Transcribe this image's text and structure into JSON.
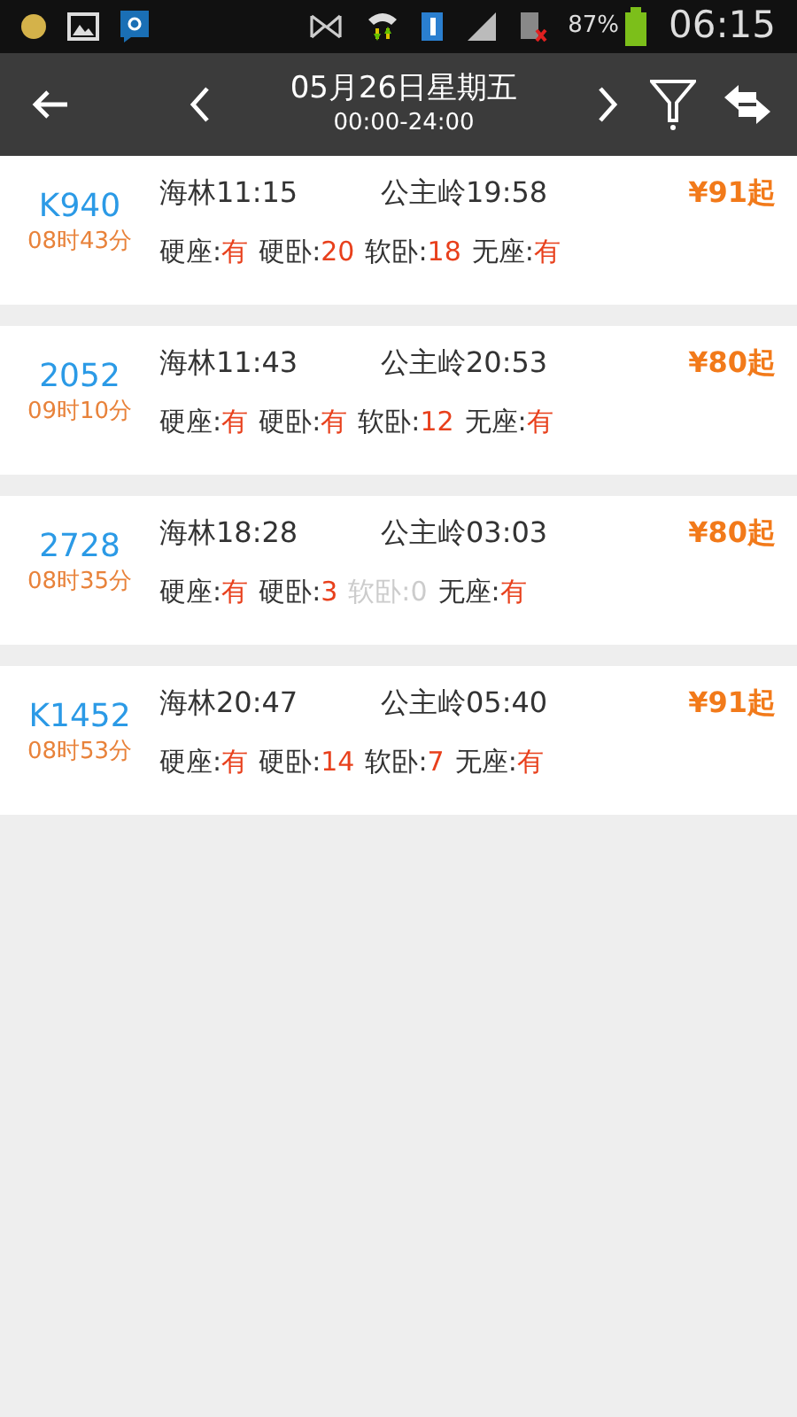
{
  "status_bar": {
    "battery": "87%",
    "time": "06:15"
  },
  "header": {
    "date": "05月26日星期五",
    "time_range": "00:00-24:00"
  },
  "trains": [
    {
      "number": "K940",
      "duration": "08时43分",
      "depart": "海林11:15",
      "arrive": "公主岭19:58",
      "price": "¥91起",
      "seats": [
        {
          "label": "硬座:",
          "value": "有",
          "disabled": false
        },
        {
          "label": "硬卧:",
          "value": "20",
          "disabled": false
        },
        {
          "label": "软卧:",
          "value": "18",
          "disabled": false
        },
        {
          "label": "无座:",
          "value": "有",
          "disabled": false
        }
      ]
    },
    {
      "number": "2052",
      "duration": "09时10分",
      "depart": "海林11:43",
      "arrive": "公主岭20:53",
      "price": "¥80起",
      "seats": [
        {
          "label": "硬座:",
          "value": "有",
          "disabled": false
        },
        {
          "label": "硬卧:",
          "value": "有",
          "disabled": false
        },
        {
          "label": "软卧:",
          "value": "12",
          "disabled": false
        },
        {
          "label": "无座:",
          "value": "有",
          "disabled": false
        }
      ]
    },
    {
      "number": "2728",
      "duration": "08时35分",
      "depart": "海林18:28",
      "arrive": "公主岭03:03",
      "price": "¥80起",
      "seats": [
        {
          "label": "硬座:",
          "value": "有",
          "disabled": false
        },
        {
          "label": "硬卧:",
          "value": "3",
          "disabled": false
        },
        {
          "label": "软卧:",
          "value": "0",
          "disabled": true
        },
        {
          "label": "无座:",
          "value": "有",
          "disabled": false
        }
      ]
    },
    {
      "number": "K1452",
      "duration": "08时53分",
      "depart": "海林20:47",
      "arrive": "公主岭05:40",
      "price": "¥91起",
      "seats": [
        {
          "label": "硬座:",
          "value": "有",
          "disabled": false
        },
        {
          "label": "硬卧:",
          "value": "14",
          "disabled": false
        },
        {
          "label": "软卧:",
          "value": "7",
          "disabled": false
        },
        {
          "label": "无座:",
          "value": "有",
          "disabled": false
        }
      ]
    }
  ]
}
